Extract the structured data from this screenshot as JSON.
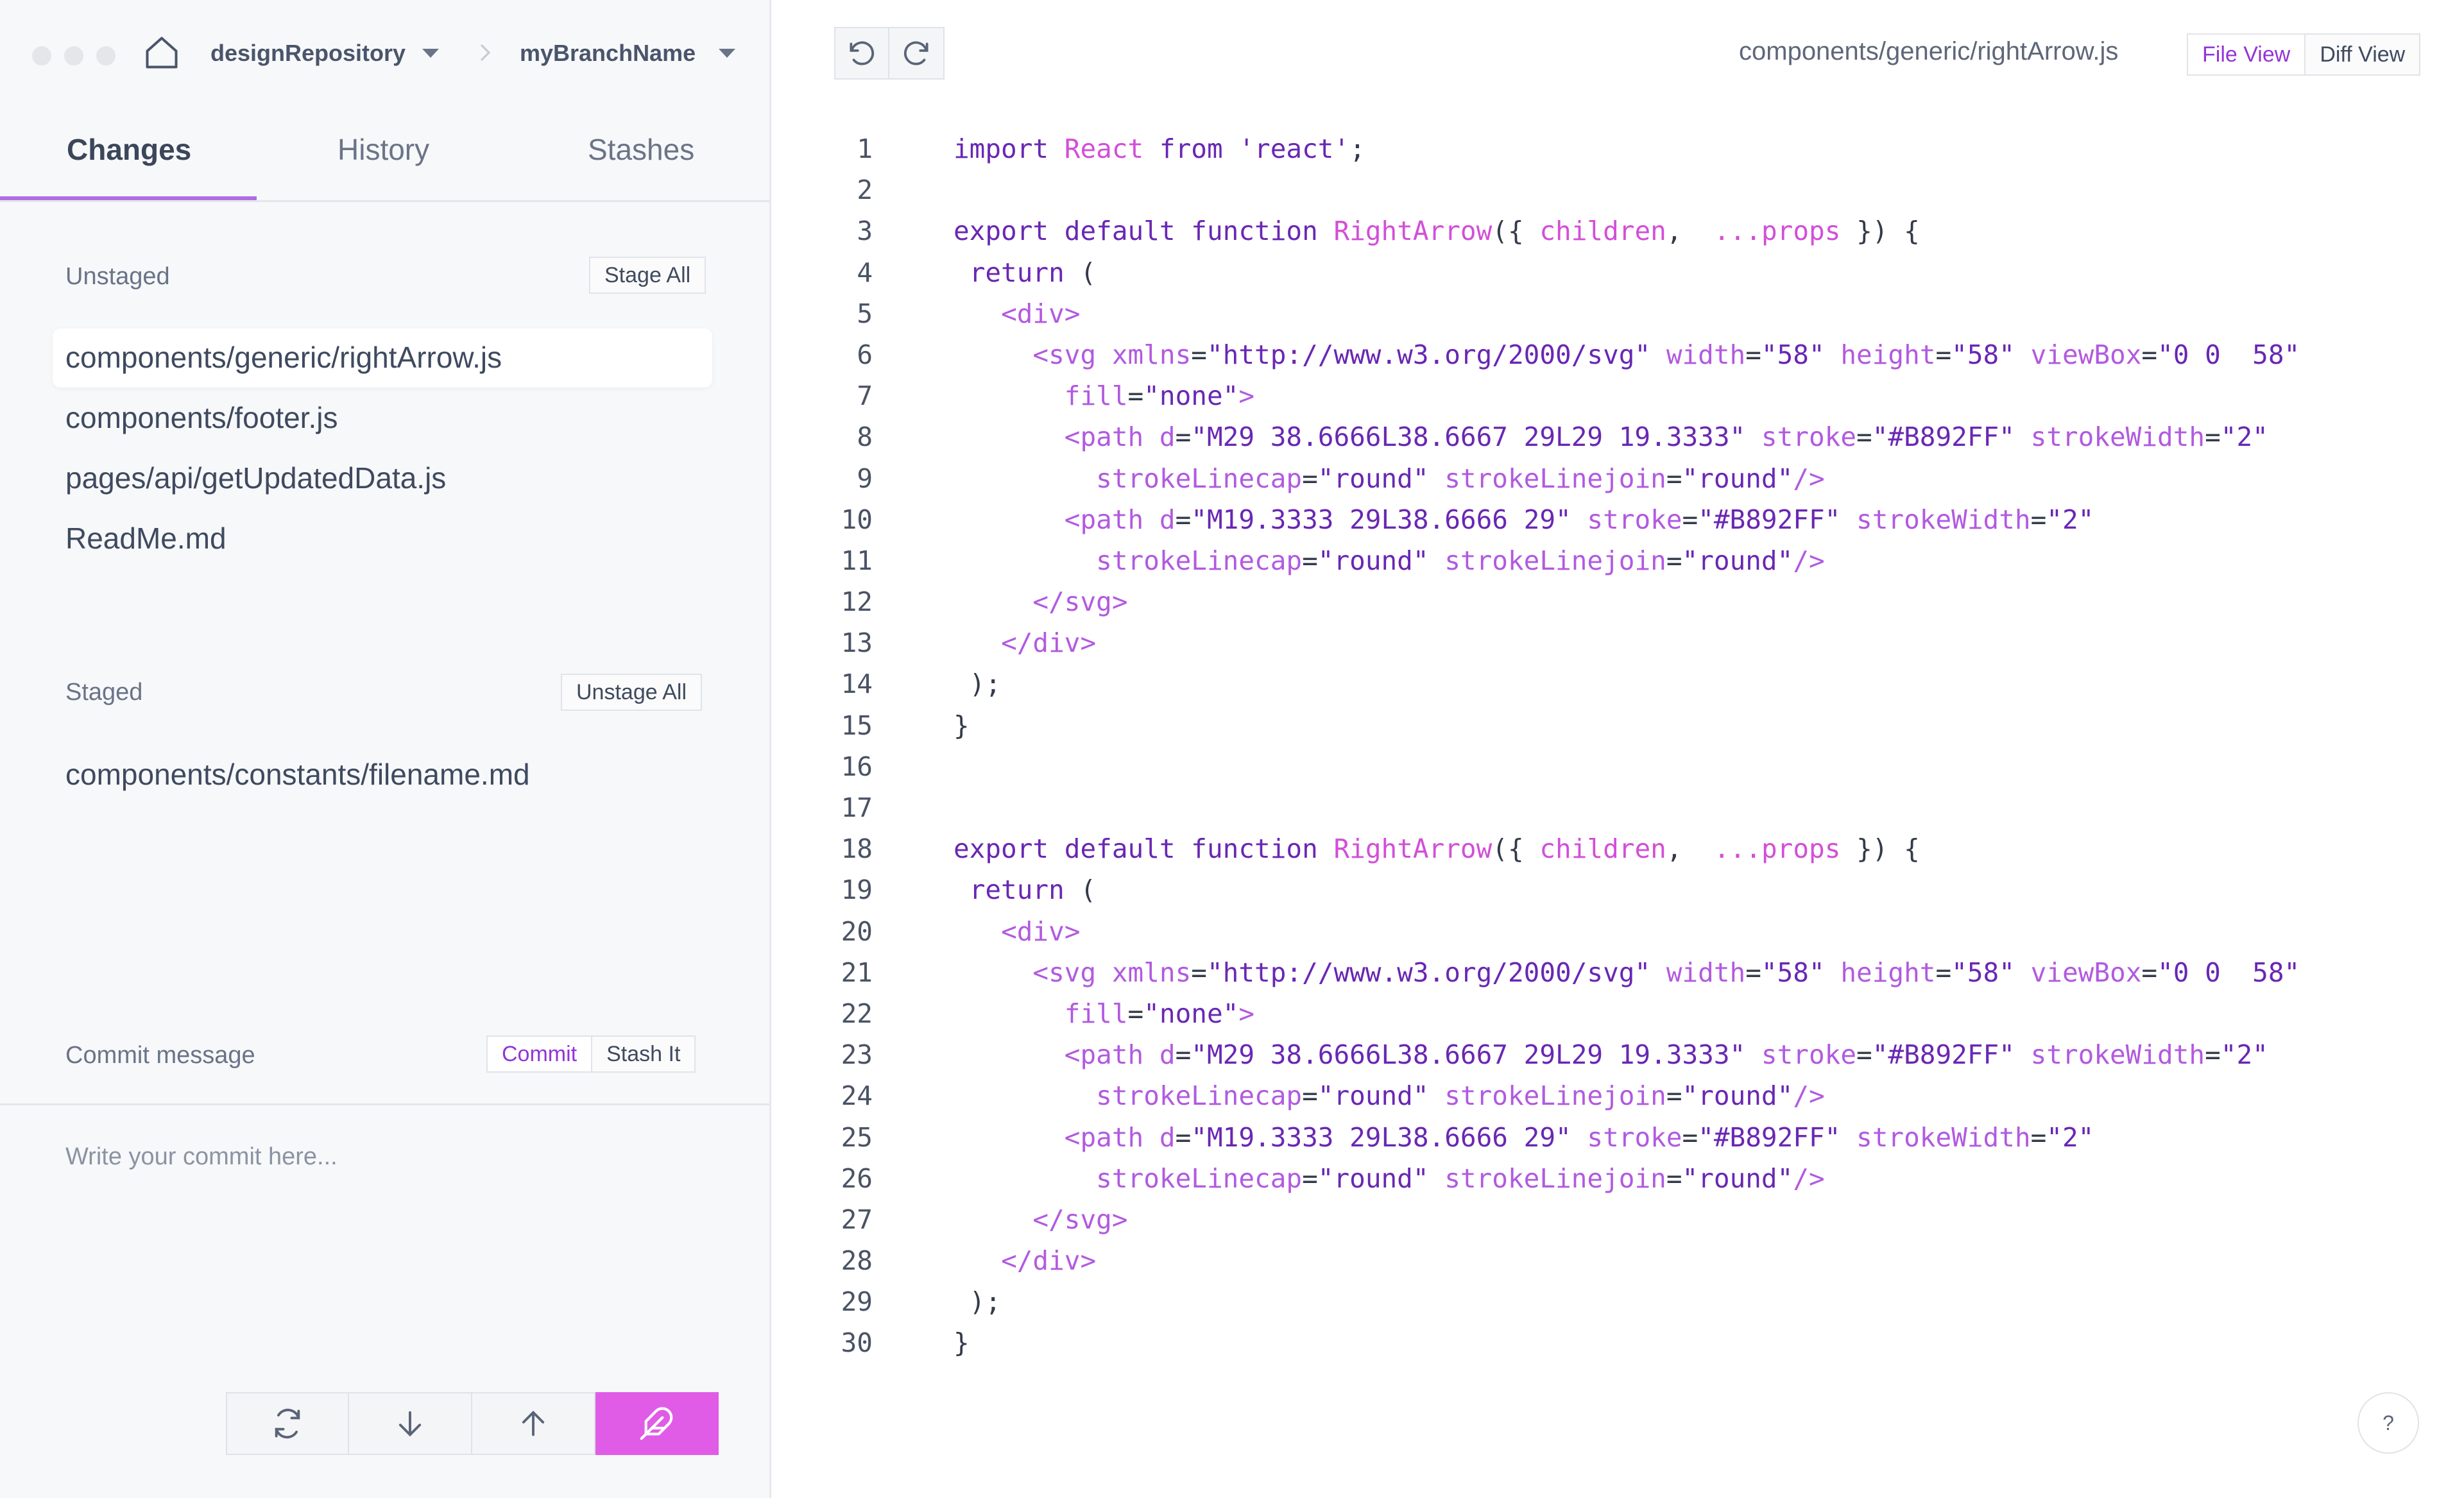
{
  "header": {
    "repository": "designRepository",
    "branch": "myBranchName",
    "icons": [
      "home-icon",
      "chevron-right-icon",
      "caret-down-icon"
    ]
  },
  "tabs": [
    {
      "label": "Changes",
      "active": true
    },
    {
      "label": "History",
      "active": false
    },
    {
      "label": "Stashes",
      "active": false
    }
  ],
  "unstaged": {
    "label": "Unstaged",
    "action": "Stage All",
    "files": [
      {
        "name": "components/generic/rightArrow.js",
        "selected": true
      },
      {
        "name": "components/footer.js",
        "selected": false
      },
      {
        "name": "pages/api/getUpdatedData.js",
        "selected": false
      },
      {
        "name": "ReadMe.md",
        "selected": false
      }
    ]
  },
  "staged": {
    "label": "Staged",
    "action": "Unstage All",
    "files": [
      {
        "name": "components/constants/filename.md"
      }
    ]
  },
  "commit": {
    "label": "Commit message",
    "commit_button": "Commit",
    "stash_button": "Stash It",
    "placeholder": "Write your commit here..."
  },
  "actions": [
    "sync-icon",
    "pull-icon",
    "push-icon",
    "feather-icon"
  ],
  "editor": {
    "file_path": "components/generic/rightArrow.js",
    "file_view": "File View",
    "diff_view": "Diff View",
    "help": "?",
    "history_icons": [
      "undo-icon",
      "redo-icon"
    ],
    "lines": [
      "import React from 'react';",
      "",
      "export default function RightArrow({ children,  ...props }) {",
      " return (",
      "   <div>",
      "     <svg xmlns=\"http://www.w3.org/2000/svg\" width=\"58\" height=\"58\" viewBox=\"0 0  58\"",
      "       fill=\"none\">",
      "       <path d=\"M29 38.6666L38.6667 29L29 19.3333\" stroke=\"#B892FF\" strokeWidth=\"2\"",
      "         strokeLinecap=\"round\" strokeLinejoin=\"round\"/>",
      "       <path d=\"M19.3333 29L38.6666 29\" stroke=\"#B892FF\" strokeWidth=\"2\"",
      "         strokeLinecap=\"round\" strokeLinejoin=\"round\"/>",
      "     </svg>",
      "   </div>",
      " );",
      "}",
      "",
      "",
      "export default function RightArrow({ children,  ...props }) {",
      " return (",
      "   <div>",
      "     <svg xmlns=\"http://www.w3.org/2000/svg\" width=\"58\" height=\"58\" viewBox=\"0 0  58\"",
      "       fill=\"none\">",
      "       <path d=\"M29 38.6666L38.6667 29L29 19.3333\" stroke=\"#B892FF\" strokeWidth=\"2\"",
      "         strokeLinecap=\"round\" strokeLinejoin=\"round\"/>",
      "       <path d=\"M19.3333 29L38.6666 29\" stroke=\"#B892FF\" strokeWidth=\"2\"",
      "         strokeLinecap=\"round\" strokeLinejoin=\"round\"/>",
      "     </svg>",
      "   </div>",
      " );",
      "}"
    ]
  },
  "colors": {
    "accent": "#b06ce6",
    "push": "#e05ce6",
    "keyword": "#6927b3",
    "name": "#d24fd8"
  }
}
